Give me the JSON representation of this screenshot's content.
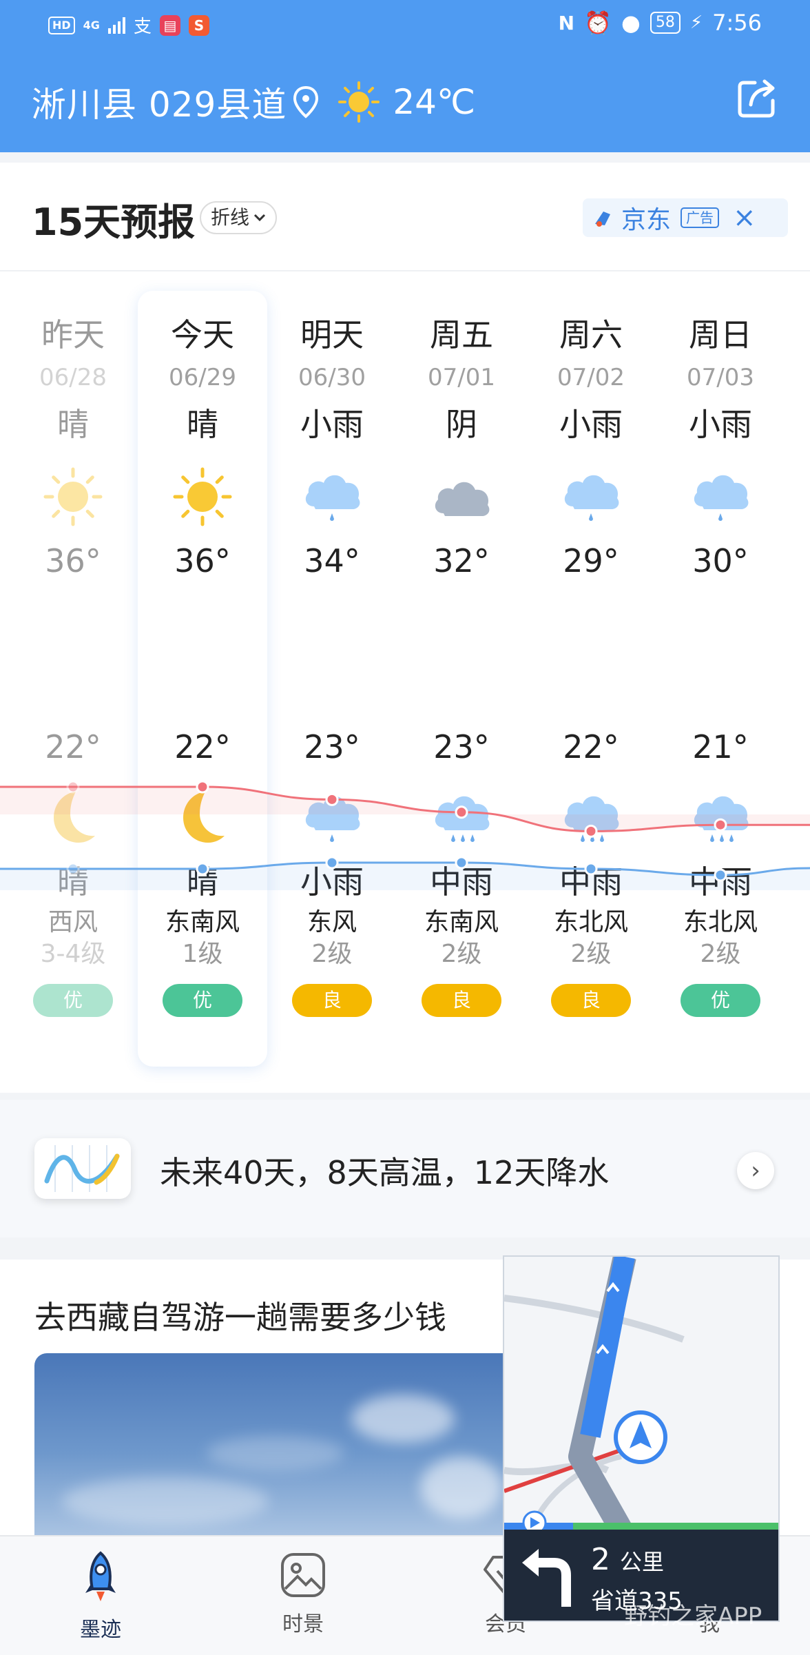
{
  "status_bar": {
    "left_badge": "HD",
    "network": "4G",
    "time": "7:56",
    "battery": "58"
  },
  "header": {
    "location": "淅川县 029县道",
    "current_temp": "24℃"
  },
  "forecast": {
    "title": "15天预报",
    "mode": "折线",
    "ad_brand": "京东",
    "ad_tag": "广告",
    "ad_close": "×",
    "days": [
      {
        "name": "昨天",
        "date": "06/28",
        "day_wx": "晴",
        "day_icon": "sun-icon",
        "high": "36°",
        "low": "22°",
        "night_icon": "moon-icon",
        "night_wx": "晴",
        "wind": "西风",
        "level": "3-4级",
        "aqi": "优",
        "aqi_color": "#4cc597",
        "past": true
      },
      {
        "name": "今天",
        "date": "06/29",
        "day_wx": "晴",
        "day_icon": "sun-icon",
        "high": "36°",
        "low": "22°",
        "night_icon": "moon-icon",
        "night_wx": "晴",
        "wind": "东南风",
        "level": "1级",
        "aqi": "优",
        "aqi_color": "#4cc597",
        "past": false
      },
      {
        "name": "明天",
        "date": "06/30",
        "day_wx": "小雨",
        "day_icon": "light-rain-icon",
        "high": "34°",
        "low": "23°",
        "night_icon": "light-rain-icon",
        "night_wx": "小雨",
        "wind": "东风",
        "level": "2级",
        "aqi": "良",
        "aqi_color": "#f5b800",
        "past": false
      },
      {
        "name": "周五",
        "date": "07/01",
        "day_wx": "阴",
        "day_icon": "overcast-icon",
        "high": "32°",
        "low": "23°",
        "night_icon": "moderate-rain-icon",
        "night_wx": "中雨",
        "wind": "东南风",
        "level": "2级",
        "aqi": "良",
        "aqi_color": "#f5b800",
        "past": false
      },
      {
        "name": "周六",
        "date": "07/02",
        "day_wx": "小雨",
        "day_icon": "light-rain-icon",
        "high": "29°",
        "low": "22°",
        "night_icon": "moderate-rain-icon",
        "night_wx": "中雨",
        "wind": "东北风",
        "level": "2级",
        "aqi": "良",
        "aqi_color": "#f5b800",
        "past": false
      },
      {
        "name": "周日",
        "date": "07/03",
        "day_wx": "小雨",
        "day_icon": "light-rain-icon",
        "high": "30°",
        "low": "21°",
        "night_icon": "moderate-rain-icon",
        "night_wx": "中雨",
        "wind": "东北风",
        "level": "2级",
        "aqi": "优",
        "aqi_color": "#4cc597",
        "past": false
      }
    ]
  },
  "chart_data": {
    "type": "line",
    "categories": [
      "06/28",
      "06/29",
      "06/30",
      "07/01",
      "07/02",
      "07/03"
    ],
    "series": [
      {
        "values": [
          36,
          36,
          34,
          32,
          29,
          30
        ],
        "color": "#f0727a"
      },
      {
        "values": [
          22,
          22,
          23,
          23,
          22,
          21
        ],
        "color": "#6aa9ea"
      }
    ]
  },
  "promo": {
    "text": "未来40天，8天高温，12天降水"
  },
  "article": {
    "title": "去西藏自驾游一趟需要多少钱"
  },
  "tabbar": {
    "tabs": [
      {
        "label": "墨迹",
        "icon": "rocket-icon",
        "active": true
      },
      {
        "label": "时景",
        "icon": "picture-icon",
        "active": false
      },
      {
        "label": "会员",
        "icon": "diamond-icon",
        "active": false
      },
      {
        "label": "我",
        "icon": "user-icon",
        "active": false
      }
    ]
  },
  "navigation": {
    "distance": "2",
    "unit": "公里",
    "road": "省道335"
  },
  "watermark": "野钓之家APP"
}
